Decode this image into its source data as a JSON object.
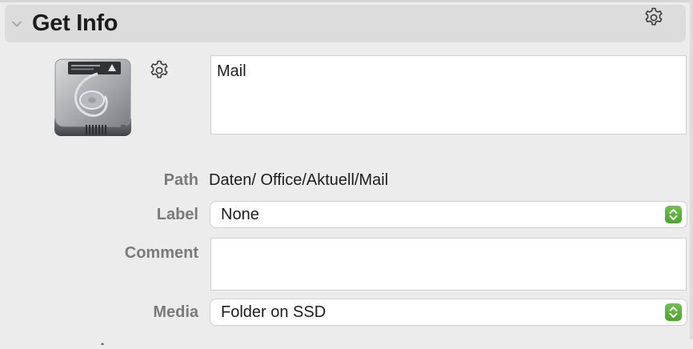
{
  "panel": {
    "title": "Get Info",
    "collapse_icon": "chevron-down-icon",
    "action_icon": "gear-icon"
  },
  "item": {
    "icon": "hard-drive-icon",
    "action_icon": "gear-icon",
    "name": "Mail"
  },
  "fields": {
    "path_label": "Path",
    "path_value": "Daten/ Office/Aktuell/Mail",
    "label_label": "Label",
    "label_value": "None",
    "comment_label": "Comment",
    "comment_value": "",
    "media_label": "Media",
    "media_value": "Folder on SSD"
  },
  "colors": {
    "accent": "#5bb33c",
    "background": "#ececec",
    "header": "#dcdcdc"
  }
}
